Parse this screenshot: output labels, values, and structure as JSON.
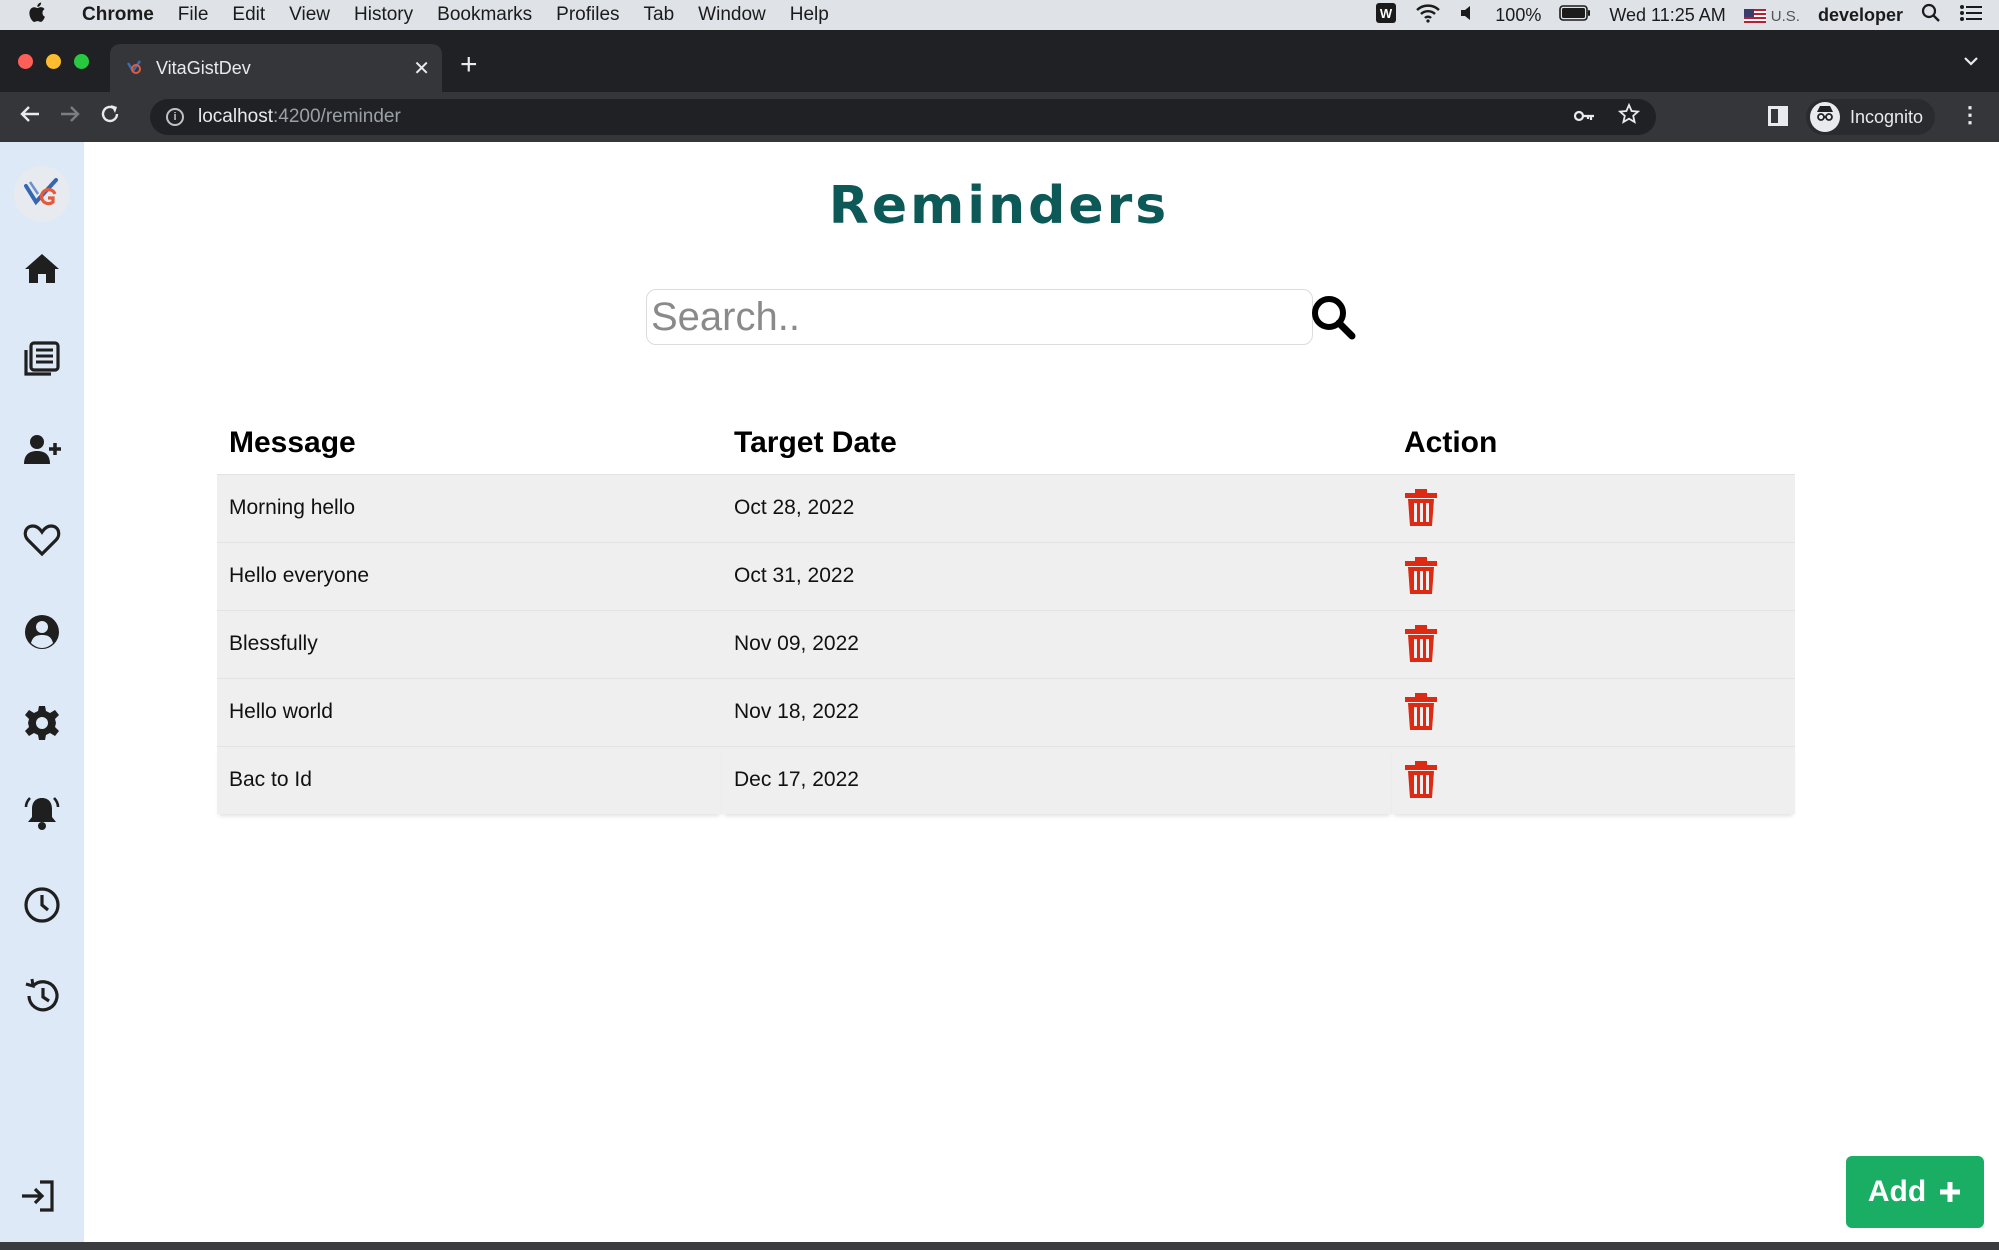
{
  "menubar": {
    "app_name": "Chrome",
    "items": [
      "File",
      "Edit",
      "View",
      "History",
      "Bookmarks",
      "Profiles",
      "Tab",
      "Window",
      "Help"
    ],
    "battery": "100%",
    "clock": "Wed 11:25 AM",
    "input_source": "U.S.",
    "user": "developer"
  },
  "browser": {
    "tab_title": "VitaGistDev",
    "url_host": "localhost",
    "url_path": ":4200/reminder",
    "profile_label": "Incognito"
  },
  "page": {
    "title": "Reminders",
    "search_placeholder": "Search..",
    "add_label": "Add"
  },
  "table": {
    "headers": {
      "message": "Message",
      "target_date": "Target Date",
      "action": "Action"
    },
    "rows": [
      {
        "message": "Morning hello",
        "date": "Oct 28, 2022"
      },
      {
        "message": "Hello everyone",
        "date": "Oct 31, 2022"
      },
      {
        "message": "Blessfully",
        "date": "Nov 09, 2022"
      },
      {
        "message": "Hello world",
        "date": "Nov 18, 2022"
      },
      {
        "message": "Bac to Id",
        "date": "Dec 17, 2022"
      }
    ]
  },
  "sidebar_icons": [
    "home-icon",
    "news-icon",
    "add-user-icon",
    "heart-icon",
    "user-circle-icon",
    "gear-icon",
    "bell-icon",
    "clock-icon",
    "history-icon",
    "logout-icon"
  ],
  "colors": {
    "title": "#0d5957",
    "delete": "#dd2a12",
    "add": "#1aad64",
    "sidebar": "#dde9f6"
  }
}
